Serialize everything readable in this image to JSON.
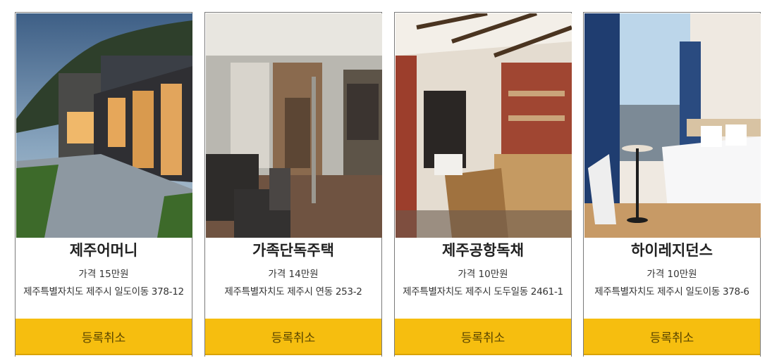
{
  "listings": [
    {
      "name": "제주어머니",
      "price": "가격 15만원",
      "address": "제주특별자치도 제주시 일도이동 378-12",
      "cancel_label": "등록취소"
    },
    {
      "name": "가족단독주택",
      "price": "가격 14만원",
      "address": "제주특별자치도 제주시 연동 253-2",
      "cancel_label": "등록취소"
    },
    {
      "name": "제주공항독채",
      "price": "가격 10만원",
      "address": "제주특별자치도 제주시 도두일동 2461-1",
      "cancel_label": "등록취소"
    },
    {
      "name": "하이레지던스",
      "price": "가격 10만원",
      "address": "제주특별자치도 제주시 일도이동 378-6",
      "cancel_label": "등록취소"
    }
  ],
  "colors": {
    "button_background": "#f6be0f",
    "button_text": "#5a4600",
    "card_border": "#7a7a7a"
  }
}
